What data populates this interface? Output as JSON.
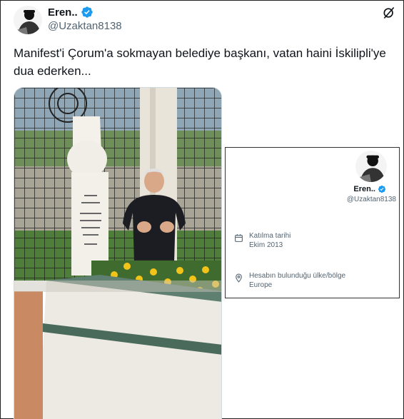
{
  "tweet": {
    "author_name": "Eren..",
    "author_handle": "@Uzaktan8138",
    "text": "Manifest'i Çorum'a sokmayan belediye başkanı, vatan haini İskilipli'ye dua ederken...",
    "verified_color": "#1d9bf0"
  },
  "profile_card": {
    "name": "Eren..",
    "handle": "@Uzaktan8138",
    "joined_label": "Katılma tarihi",
    "joined_value": "Ekim 2013",
    "location_label": "Hesabın bulunduğu ülke/bölge",
    "location_value": "Europe"
  },
  "icons": {
    "verified": "verified-badge-icon",
    "grok": "grok-icon",
    "calendar": "calendar-icon",
    "location": "location-pin-icon"
  }
}
